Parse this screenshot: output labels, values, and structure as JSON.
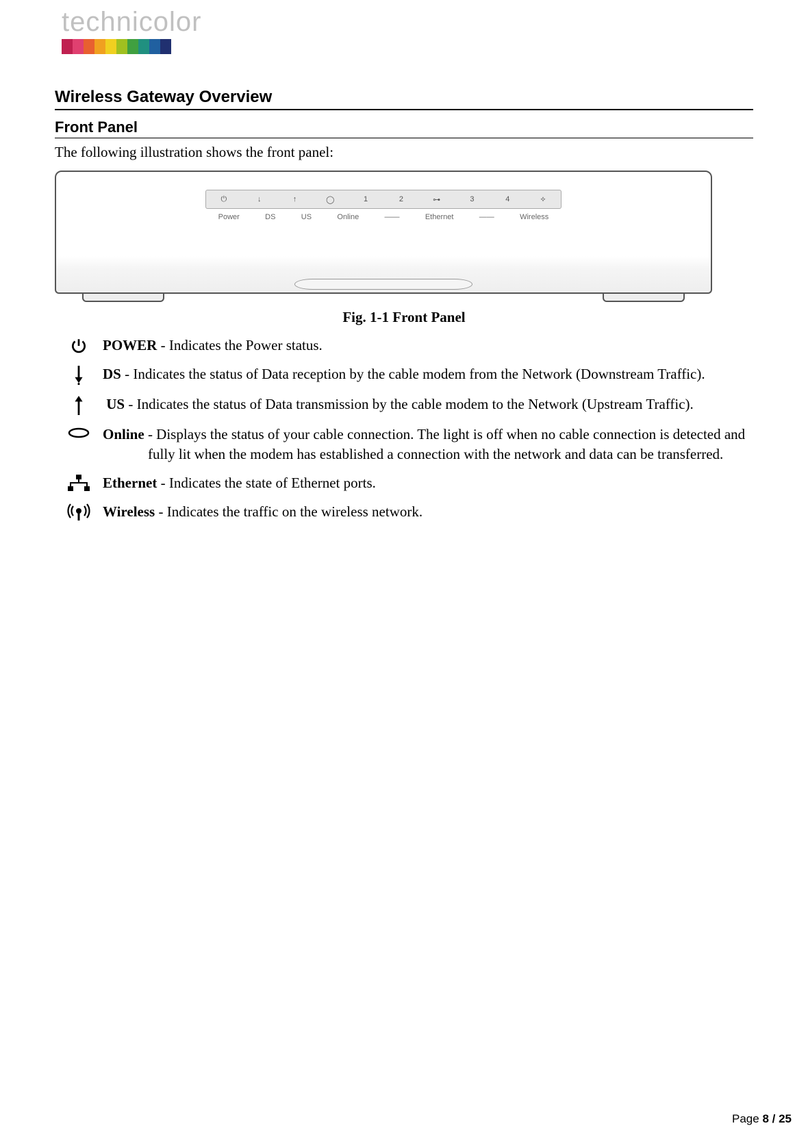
{
  "brand": "technicolor",
  "section_title": "Wireless Gateway Overview",
  "subsection_title": "Front Panel",
  "intro_text": "The following illustration shows the front panel:",
  "figure_caption": "Fig. 1-1 Front Panel",
  "panel_labels": {
    "power": "Power",
    "ds": "DS",
    "us": "US",
    "online": "Online",
    "ethernet": "Ethernet",
    "wireless": "Wireless",
    "nums": [
      "1",
      "2",
      "3",
      "4"
    ]
  },
  "definitions": [
    {
      "label": "POWER",
      "desc": " - Indicates the Power status."
    },
    {
      "label": "DS",
      "desc": " - Indicates the status of Data reception by the cable modem from the Network (Downstream Traffic)."
    },
    {
      "label": "US",
      "desc": " - Indicates the status of Data transmission by the cable modem to the Network (Upstream Traffic)."
    },
    {
      "label": "Online",
      "desc": " - Displays the status of your cable connection. The light is off when no cable connection is detected   and fully lit when the modem has established a connection with the network and data can be transferred."
    },
    {
      "label": "Ethernet",
      "desc": " - Indicates the state of Ethernet ports."
    },
    {
      "label": "Wireless",
      "desc": " - Indicates the traffic on the wireless network."
    }
  ],
  "footer": {
    "prefix": "Page ",
    "current": "8",
    "sep": " / ",
    "total": "25"
  }
}
